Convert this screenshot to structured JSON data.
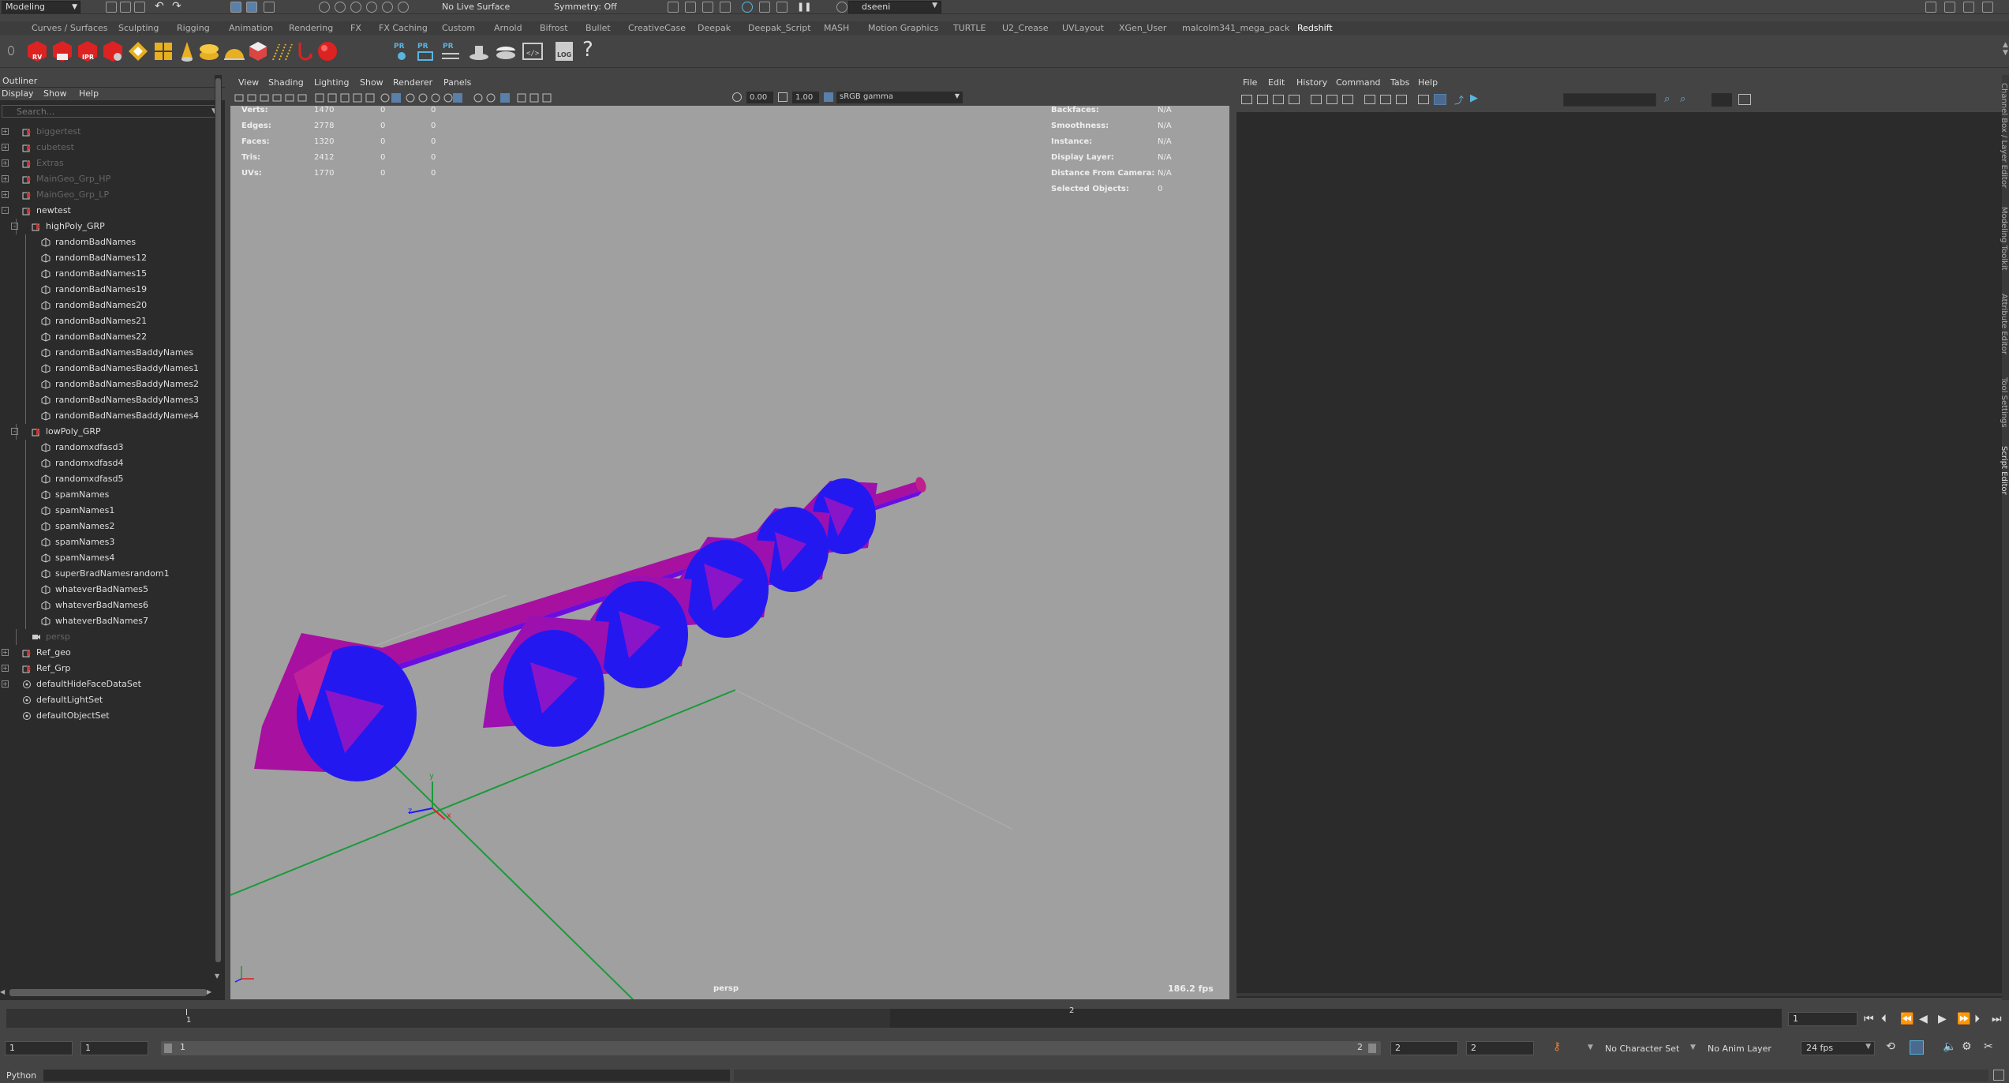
{
  "topbar": {
    "menu_set": "Modeling",
    "live_surface": "No Live Surface",
    "symmetry": "Symmetry: Off",
    "user": "dseeni"
  },
  "shelf_tabs": [
    "Curves / Surfaces",
    "Sculpting",
    "Rigging",
    "Animation",
    "Rendering",
    "FX",
    "FX Caching",
    "Custom",
    "Arnold",
    "Bifrost",
    "Bullet",
    "CreativeCase",
    "Deepak",
    "Deepak_Script",
    "MASH",
    "Motion Graphics",
    "TURTLE",
    "U2_Crease",
    "UVLayout",
    "XGen_User",
    "malcolm341_mega_pack",
    "Redshift"
  ],
  "active_shelf": "Redshift",
  "shelf_labels": {
    "rv": "RV",
    "ipr": "IPR",
    "pr": "PR",
    "log": "LOG",
    "help": "?"
  },
  "outliner": {
    "title": "Outliner",
    "menu": [
      "Display",
      "Show",
      "Help"
    ],
    "search_placeholder": "Search...",
    "items": [
      {
        "label": "biggertest",
        "dim": true
      },
      {
        "label": "cubetest",
        "dim": true
      },
      {
        "label": "Extras",
        "dim": true
      },
      {
        "label": "MainGeo_Grp_HP",
        "dim": true
      },
      {
        "label": "MainGeo_Grp_LP",
        "dim": true
      },
      {
        "label": "newtest",
        "dim": false
      },
      {
        "label": "highPoly_GRP",
        "dim": false
      },
      {
        "label": "randomBadNames",
        "dim": false
      },
      {
        "label": "randomBadNames12",
        "dim": false
      },
      {
        "label": "randomBadNames15",
        "dim": false
      },
      {
        "label": "randomBadNames19",
        "dim": false
      },
      {
        "label": "randomBadNames20",
        "dim": false
      },
      {
        "label": "randomBadNames21",
        "dim": false
      },
      {
        "label": "randomBadNames22",
        "dim": false
      },
      {
        "label": "randomBadNamesBaddyNames",
        "dim": false
      },
      {
        "label": "randomBadNamesBaddyNames1",
        "dim": false
      },
      {
        "label": "randomBadNamesBaddyNames2",
        "dim": false
      },
      {
        "label": "randomBadNamesBaddyNames3",
        "dim": false
      },
      {
        "label": "randomBadNamesBaddyNames4",
        "dim": false
      },
      {
        "label": "lowPoly_GRP",
        "dim": false
      },
      {
        "label": "randomxdfasd3",
        "dim": false
      },
      {
        "label": "randomxdfasd4",
        "dim": false
      },
      {
        "label": "randomxdfasd5",
        "dim": false
      },
      {
        "label": "spamNames",
        "dim": false
      },
      {
        "label": "spamNames1",
        "dim": false
      },
      {
        "label": "spamNames2",
        "dim": false
      },
      {
        "label": "spamNames3",
        "dim": false
      },
      {
        "label": "spamNames4",
        "dim": false
      },
      {
        "label": "superBradNamesrandom1",
        "dim": false
      },
      {
        "label": "whateverBadNames5",
        "dim": false
      },
      {
        "label": "whateverBadNames6",
        "dim": false
      },
      {
        "label": "whateverBadNames7",
        "dim": false
      },
      {
        "label": "persp",
        "dim": true
      },
      {
        "label": "Ref_geo",
        "dim": false
      },
      {
        "label": "Ref_Grp",
        "dim": false
      },
      {
        "label": "defaultHideFaceDataSet",
        "dim": false
      },
      {
        "label": "defaultLightSet",
        "dim": false
      },
      {
        "label": "defaultObjectSet",
        "dim": false
      }
    ]
  },
  "viewport": {
    "menu": [
      "View",
      "Shading",
      "Lighting",
      "Show",
      "Renderer",
      "Panels"
    ],
    "exposure": "0.00",
    "gamma": "1.00",
    "color_space": "sRGB gamma",
    "camera": "persp",
    "fps": "186.2 fps",
    "hud_left": [
      {
        "label": "Verts:",
        "v1": "1470",
        "v2": "0",
        "v3": "0"
      },
      {
        "label": "Edges:",
        "v1": "2778",
        "v2": "0",
        "v3": "0"
      },
      {
        "label": "Faces:",
        "v1": "1320",
        "v2": "0",
        "v3": "0"
      },
      {
        "label": "Tris:",
        "v1": "2412",
        "v2": "0",
        "v3": "0"
      },
      {
        "label": "UVs:",
        "v1": "1770",
        "v2": "0",
        "v3": "0"
      }
    ],
    "hud_right": [
      {
        "label": "Backfaces:",
        "value": "N/A"
      },
      {
        "label": "Smoothness:",
        "value": "N/A"
      },
      {
        "label": "Instance:",
        "value": "N/A"
      },
      {
        "label": "Display Layer:",
        "value": "N/A"
      },
      {
        "label": "Distance From Camera:",
        "value": "N/A"
      },
      {
        "label": "Selected Objects:",
        "value": "0"
      }
    ],
    "axis": {
      "x": "x",
      "y": "y",
      "z": "z"
    }
  },
  "script_editor": {
    "menu": [
      "File",
      "Edit",
      "History",
      "Command",
      "Tabs",
      "Help"
    ]
  },
  "side_tabs": [
    "Channel Box / Layer Editor",
    "Modeling Toolkit",
    "Attribute Editor",
    "Tool Settings",
    "Script Editor"
  ],
  "timeline": {
    "tick_1": "1",
    "tick_2": "2",
    "current_frame": "1",
    "range_start": "1",
    "playback_start": "1",
    "range_slider_start": "1",
    "range_slider_end": "2",
    "playback_end": "2",
    "range_end": "2",
    "character_set": "No Character Set",
    "anim_layer": "No Anim Layer",
    "fps": "24 fps"
  },
  "command_line": {
    "label": "Python"
  },
  "colors": {
    "mesh_blue": "#1a1aff",
    "mesh_magenta": "#b0109a",
    "grid_green": "#1a9a3a",
    "viewport_bg": "#a0a0a0"
  }
}
